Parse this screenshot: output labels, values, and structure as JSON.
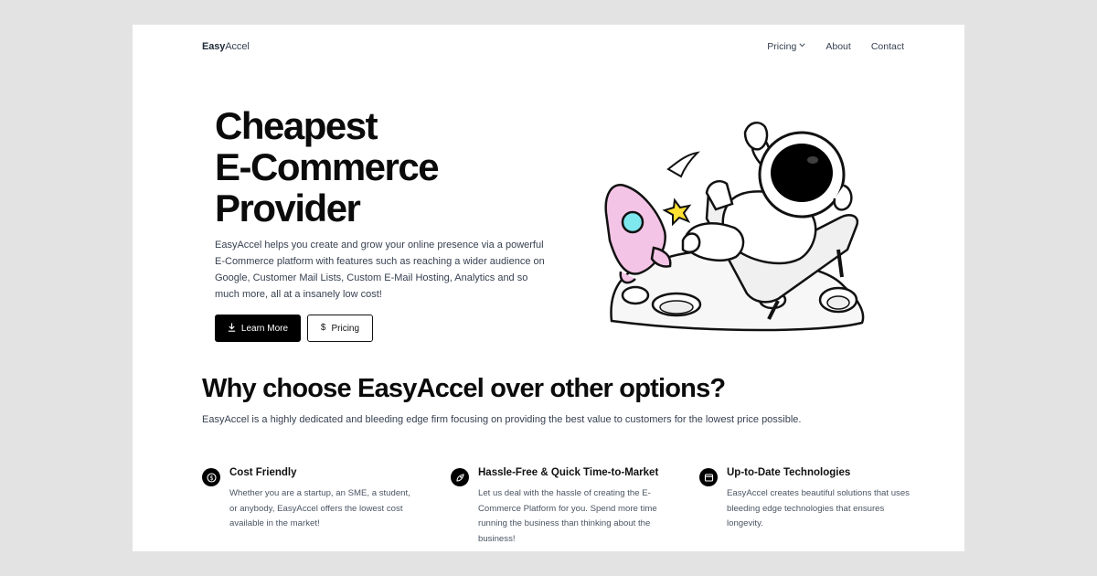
{
  "nav": {
    "logo_bold": "Easy",
    "logo_regular": "Accel",
    "links": [
      {
        "label": "Pricing",
        "has_dropdown": true
      },
      {
        "label": "About"
      },
      {
        "label": "Contact"
      }
    ]
  },
  "hero": {
    "title_lines": [
      "Cheapest",
      "E-Commerce",
      "Provider"
    ],
    "description": "EasyAccel helps you create and grow your online presence via a powerful E-Commerce platform with features such as reaching a wider audience on Google, Customer Mail Lists, Custom E-Mail Hosting, Analytics and so much more, all at a insanely low cost!",
    "primary_button": {
      "label": "Learn More",
      "icon": "download-icon"
    },
    "secondary_button": {
      "label": "Pricing",
      "icon": "dollar-icon"
    }
  },
  "why": {
    "title": "Why choose EasyAccel over other options?",
    "description": "EasyAccel is a highly dedicated and bleeding edge firm focusing on providing the best value to customers for the lowest price possible.",
    "features": [
      {
        "icon": "dollar-icon",
        "title": "Cost Friendly",
        "description": "Whether you are a startup, an SME, a student, or anybody, EasyAccel offers the lowest cost available in the market!"
      },
      {
        "icon": "rocket-icon",
        "title": "Hassle-Free & Quick Time-to-Market",
        "description": "Let us deal with the hassle of creating the E-Commerce Platform for you. Spend more time running the business than thinking about the business!"
      },
      {
        "icon": "browser-icon",
        "title": "Up-to-Date Technologies",
        "description": "EasyAccel creates beautiful solutions that uses bleeding edge technologies that ensures longevity."
      }
    ]
  },
  "colors": {
    "background": "#e3e3e3",
    "page": "#ffffff",
    "primary": "#000000",
    "text_muted": "#4b5563",
    "rocket_pink": "#f4c4e6",
    "star_yellow": "#ffe033",
    "window_cyan": "#7fe7ee"
  }
}
